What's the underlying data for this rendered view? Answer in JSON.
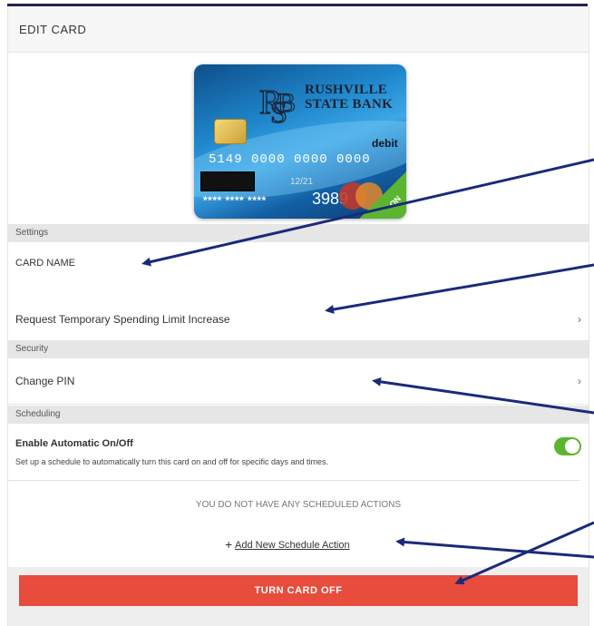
{
  "header": {
    "title": "EDIT CARD"
  },
  "card": {
    "bank_line1": "RUSHVILLE",
    "bank_line2": "STATE BANK",
    "type_label": "debit",
    "number": "5149 0000 0000 0000",
    "expiry": "12/21",
    "masked": "**** **** ****",
    "last4": "3989",
    "status_ribbon": "ON"
  },
  "sections": {
    "settings": "Settings",
    "security": "Security",
    "scheduling": "Scheduling"
  },
  "settings": {
    "card_name_label": "CARD NAME",
    "spending_limit_label": "Request Temporary Spending Limit Increase"
  },
  "security": {
    "change_pin_label": "Change PIN"
  },
  "scheduling": {
    "auto_title": "Enable Automatic On/Off",
    "auto_desc": "Set up a schedule to automatically turn this card on and off for specific days and times.",
    "auto_enabled": true,
    "empty_text": "YOU DO NOT HAVE ANY SCHEDULED ACTIONS",
    "add_label": "Add New Schedule Action"
  },
  "icons": {
    "chevron": "chevron-right-icon",
    "plus": "plus-icon",
    "toggle": "toggle-switch-icon"
  },
  "actions": {
    "turn_off_label": "TURN CARD OFF"
  },
  "colors": {
    "header_bar": "#1f2250",
    "danger": "#e74c3c",
    "toggle_on": "#5cb531",
    "annotation_arrow": "#1a2a7a"
  }
}
